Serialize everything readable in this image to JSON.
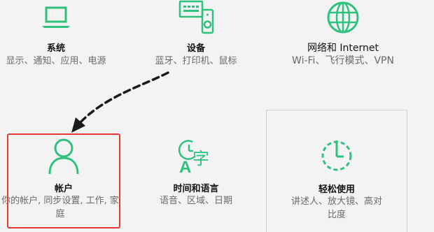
{
  "colors": {
    "accent": "#2ec27e",
    "highlight": "#e53935",
    "background": "#f3f3f3"
  },
  "tiles": [
    {
      "id": "system",
      "icon": "laptop-icon",
      "title": "系统",
      "desc": "显示、通知、应用、电源"
    },
    {
      "id": "devices",
      "icon": "devices-icon",
      "title": "设备",
      "desc": "蓝牙、打印机、鼠标"
    },
    {
      "id": "network",
      "icon": "globe-icon",
      "title": "网络和 Internet",
      "desc": "Wi-Fi、飞行模式、VPN"
    },
    {
      "id": "accounts",
      "icon": "person-icon",
      "title": "帐户",
      "desc": "你的帐户, 同步设置, 工作, 家庭"
    },
    {
      "id": "time-language",
      "icon": "time-language-icon",
      "title": "时间和语言",
      "desc": "语音、区域、日期"
    },
    {
      "id": "ease-of-access",
      "icon": "ease-of-access-icon",
      "title": "轻松使用",
      "desc": "讲述人、放大镜、高对比度"
    }
  ]
}
